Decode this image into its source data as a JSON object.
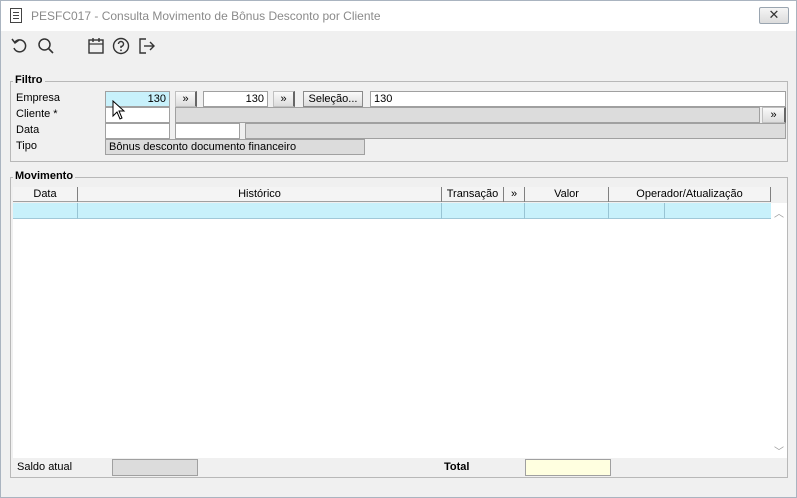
{
  "window": {
    "title": "PESFC017 - Consulta Movimento de Bônus Desconto por Cliente",
    "close_label": "✕"
  },
  "toolbar": {
    "icons": [
      "undo-icon",
      "search-icon",
      "calendar-icon",
      "help-icon",
      "exit-icon"
    ]
  },
  "filtro": {
    "title": "Filtro",
    "empresa_label": "Empresa",
    "empresa_from": "130",
    "empresa_to": "130",
    "selecao_label": "Seleção...",
    "selecao_value": "130",
    "expand_label": "»",
    "cliente_label": "Cliente *",
    "cliente_code": "",
    "cliente_name": "",
    "data_label": "Data",
    "data_from": "",
    "data_to": "",
    "tipo_label": "Tipo",
    "tipo_value": "Bônus desconto documento financeiro"
  },
  "movimento": {
    "title": "Movimento",
    "columns": {
      "data": "Data",
      "historico": "Histórico",
      "transacao": "Transação",
      "expand": "»",
      "valor": "Valor",
      "operador": "Operador/Atualização"
    },
    "rows": [],
    "saldo_label": "Saldo atual",
    "saldo_value": "",
    "total_label": "Total",
    "total_value": ""
  },
  "colors": {
    "selected_row": "#c8f1fb",
    "total_field": "#ffffe0",
    "window_bg": "#f0f0f0"
  }
}
